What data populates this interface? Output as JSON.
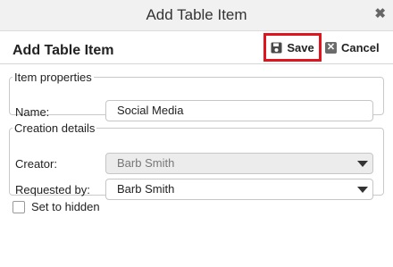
{
  "window": {
    "title": "Add Table Item",
    "close_glyph": "✖"
  },
  "header": {
    "title": "Add Table Item",
    "save_label": "Save",
    "cancel_label": "Cancel"
  },
  "item_properties": {
    "legend": "Item properties",
    "name_label": "Name:",
    "name_value": "Social Media"
  },
  "creation_details": {
    "legend": "Creation details",
    "creator_label": "Creator:",
    "creator_value": "Barb Smith",
    "requested_label": "Requested by:",
    "requested_value": "Barb Smith"
  },
  "hidden": {
    "label": "Set to hidden",
    "checked": false
  },
  "icons": {
    "save": "floppy-disk-icon",
    "cancel": "close-box-icon",
    "dropdown": "caret-down-icon"
  },
  "colors": {
    "highlight": "#e0141e",
    "disabled_bg": "#ececec"
  }
}
